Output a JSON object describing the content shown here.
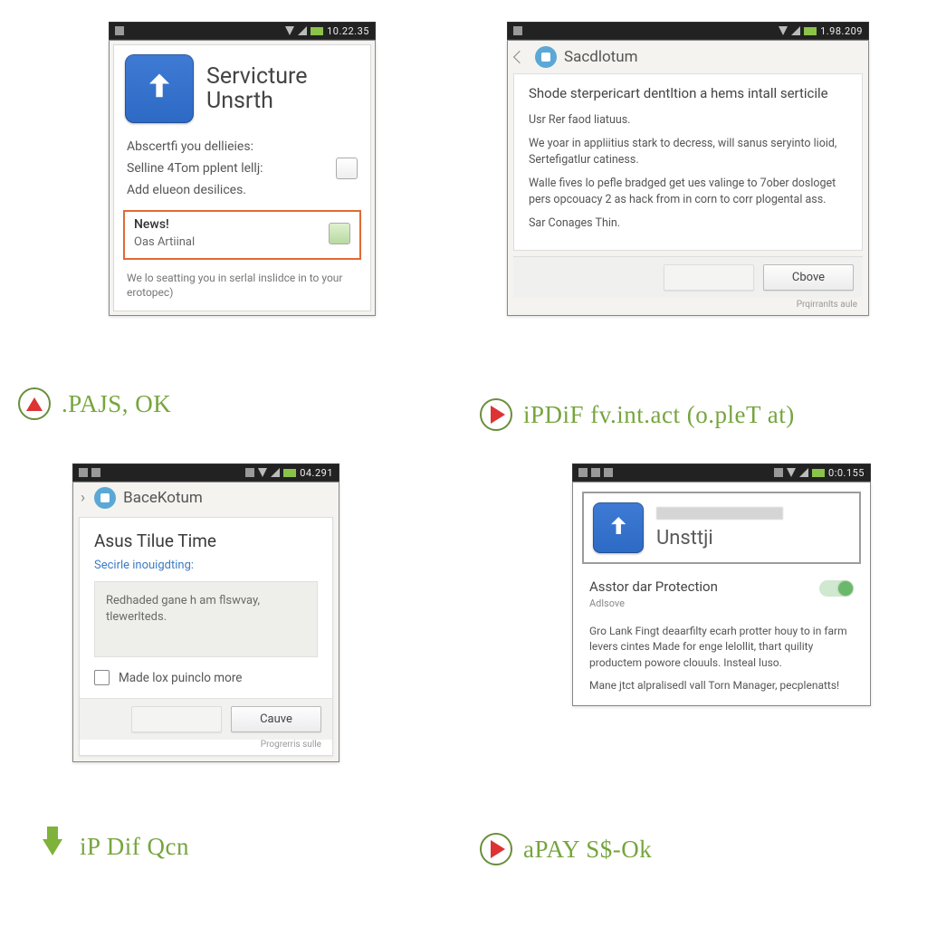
{
  "screens": {
    "s1": {
      "time": "10.22.35",
      "title_l1": "Servicture",
      "title_l2": "Unsrth",
      "list1": "Abscertfi you dellieies:",
      "list2": "Selline 4Tom pplent lellj:",
      "list3": "Add elueon desilices.",
      "hl_title": "News!",
      "hl_sub": "Oas Artiinal",
      "footnote": "We lo seatting you in serlal inslidce in to your erotopec)"
    },
    "s2": {
      "time": "1.98.209",
      "header": "Sacdlotum",
      "h": "Shode sterpericart dentltion a hems intall serticile",
      "p1": "Usr Rer faod liatuus.",
      "p2": "We yoar in appliitius stark to decress, will sanus seryinto lioid, Sertefigatlur catiness.",
      "p3": "Walle fives lo pefle bradged get ues valinge to 7ober dosloget pers opcouacy 2 as hack from in corn to corr plogental ass.",
      "p4": "Sar Conages Thin.",
      "btn_ok": "Cbove",
      "tiny": "Prqirranlts aule"
    },
    "s3": {
      "time": "04.291",
      "header": "BaceKotum",
      "dlg_title": "Asus Tilue Time",
      "dlg_sub": "Secirle inouigdting:",
      "ta": "Redhaded gane h am flswvay, tlewerlteds.",
      "chk": "Made lox puinclo more",
      "btn_ok": "Cauve",
      "tiny": "Progrerris sulle"
    },
    "s4": {
      "time": "0:0.155",
      "title": "Unsttji",
      "sec_h": "Asstor dar Protection",
      "sec_sub": "Adlsove",
      "para1": "Gro Lank Fingt deaarfilty ecarh protter houy to in farm levers cintes Made for enge lelollit, thart quility productem powore clouuls. Insteal luso.",
      "para2": "Mane jtct alpralisedl vall Torn Manager, pecplenatts!"
    }
  },
  "captions": {
    "c1": ".PAJS, OK",
    "c2": "iPDiF fv.int.act (o.pleT at)",
    "c3": "iP Dif Qcn",
    "c4": "aPAY S$-Ok"
  }
}
